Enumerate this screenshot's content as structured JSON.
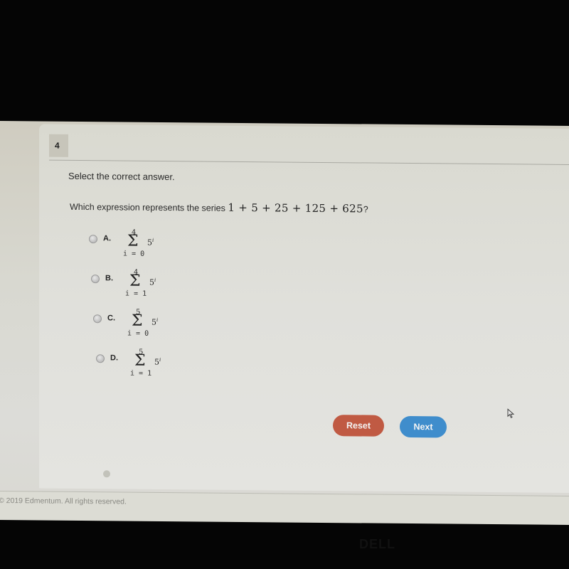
{
  "question": {
    "number": "4",
    "instruction": "Select the correct answer.",
    "prompt_text": "Which expression represents the series",
    "prompt_math": "1 + 5 + 25 + 125 + 625",
    "prompt_end": "?"
  },
  "options": [
    {
      "label": "A.",
      "upper": "4",
      "sigma": "Σ",
      "base": "5",
      "exponent": "i",
      "lower": "i = 0"
    },
    {
      "label": "B.",
      "upper": "4",
      "sigma": "Σ",
      "base": "5",
      "exponent": "i",
      "lower": "i = 1"
    },
    {
      "label": "C.",
      "upper": "5",
      "sigma": "Σ",
      "base": "5",
      "exponent": "i",
      "lower": "i = 0"
    },
    {
      "label": "D.",
      "upper": "5",
      "sigma": "Σ",
      "base": "5",
      "exponent": "i",
      "lower": "i = 1"
    }
  ],
  "buttons": {
    "reset": "Reset",
    "next": "Next"
  },
  "footer": {
    "copyright": "© 2019 Edmentum. All rights reserved."
  },
  "bezel": {
    "brand": "DELL"
  },
  "colors": {
    "reset": "#c05a43",
    "next": "#3f8dcc"
  }
}
